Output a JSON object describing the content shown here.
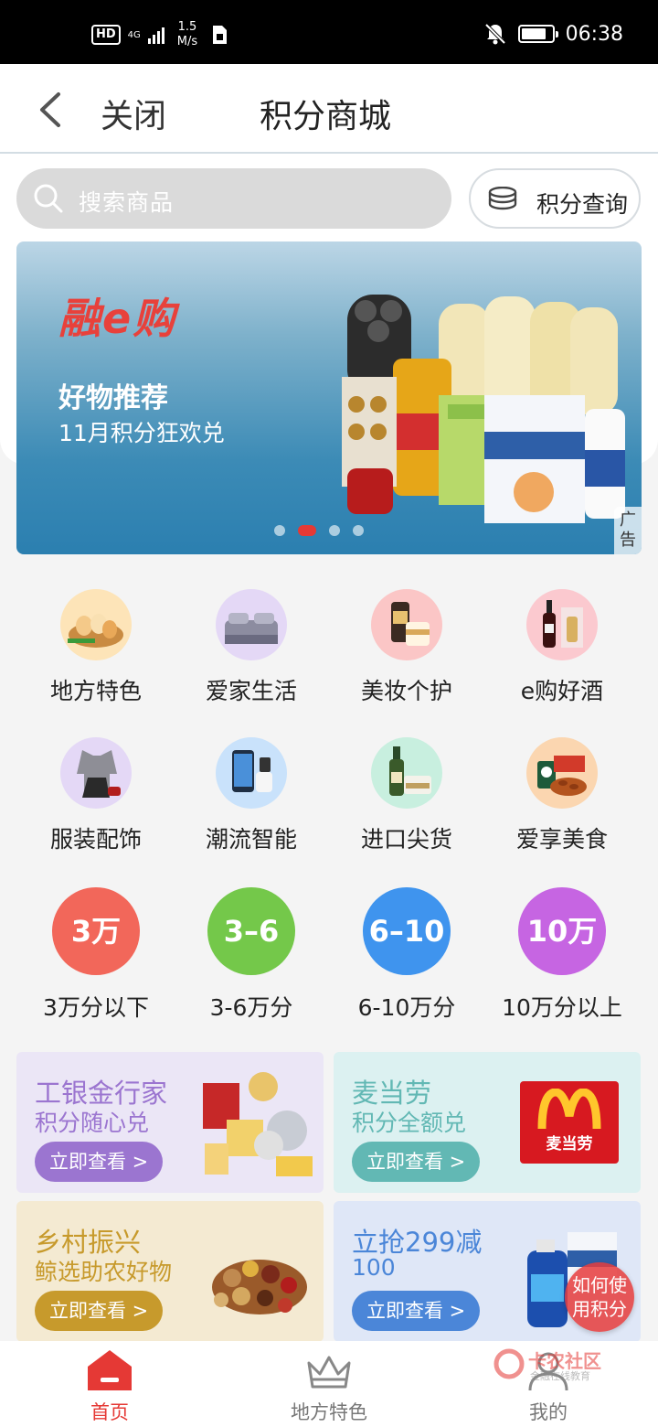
{
  "status_bar": {
    "hd": "HD",
    "network": "4G",
    "speed_value": "1.5",
    "speed_unit": "M/s",
    "time": "06:38"
  },
  "header": {
    "close_label": "关闭",
    "title": "积分商城"
  },
  "search": {
    "placeholder": "搜索商品",
    "points_query_label": "积分查询"
  },
  "banner": {
    "logo_text": "融e购",
    "headline": "好物推荐",
    "subheadline": "11月积分狂欢兑",
    "ad_tag": "广告",
    "dots": 4,
    "active_dot_index": 1
  },
  "categories": [
    {
      "label": "地方特色",
      "icon": "eggs-icon"
    },
    {
      "label": "爱家生活",
      "icon": "bedding-icon"
    },
    {
      "label": "美妆个护",
      "icon": "cosmetics-icon"
    },
    {
      "label": "e购好酒",
      "icon": "wine-icon"
    },
    {
      "label": "服装配饰",
      "icon": "clothing-icon"
    },
    {
      "label": "潮流智能",
      "icon": "smartphone-icon"
    },
    {
      "label": "进口尖货",
      "icon": "imported-goods-icon"
    },
    {
      "label": "爱享美食",
      "icon": "snacks-icon"
    }
  ],
  "point_ranges": [
    {
      "badge": "3万",
      "label": "3万分以下",
      "color": "#f2675a"
    },
    {
      "badge": "3–6",
      "label": "3-6万分",
      "color": "#74c84a"
    },
    {
      "badge": "6–10",
      "label": "6-10万分",
      "color": "#3f94ee"
    },
    {
      "badge": "10万",
      "label": "10万分以上",
      "color": "#c665e2"
    }
  ],
  "promo_cards": [
    {
      "title": "工银金行家",
      "subtitle": "积分随心兑",
      "button": "立即查看 >",
      "bg": "#ebe6f6",
      "color": "#9b75d0",
      "btn_color": "#9b75d0"
    },
    {
      "title": "麦当劳",
      "subtitle": "积分全额兑",
      "button": "立即查看 >",
      "bg": "#dcf1f1",
      "color": "#62b8b4",
      "btn_color": "#62b8b4",
      "logo_text": "麦当劳"
    },
    {
      "title": "乡村振兴",
      "subtitle": "鲸选助农好物",
      "button": "立即查看 >",
      "bg": "#f4ead2",
      "color": "#c79a2c",
      "btn_color": "#c79a2c"
    },
    {
      "title": "立抢299减",
      "subtitle": "100",
      "button": "立即查看 >",
      "bg": "#dfe7f7",
      "color": "#4b86d8",
      "btn_color": "#4b86d8"
    }
  ],
  "floating_help": {
    "line1": "如何使",
    "line2": "用积分"
  },
  "watermark": {
    "name": "卡农社区",
    "sub": "金融在线教育"
  },
  "bottom_nav": [
    {
      "label": "首页",
      "icon": "home-icon",
      "active": true
    },
    {
      "label": "地方特色",
      "icon": "crown-icon",
      "active": false
    },
    {
      "label": "我的",
      "icon": "profile-icon",
      "active": false
    }
  ],
  "colors": {
    "accent": "#e53935",
    "nav_inactive": "#777777"
  }
}
